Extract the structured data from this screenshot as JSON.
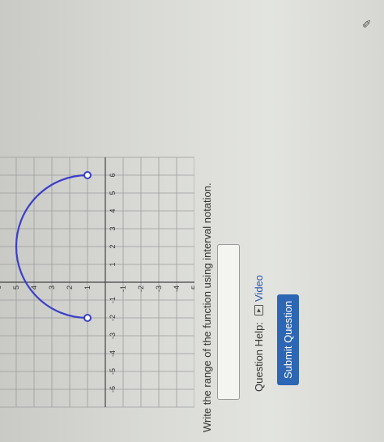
{
  "question": {
    "prompt": "Write the range of the function using interval notation.",
    "answer_value": "",
    "help_label": "Question Help:",
    "video_label": "Video",
    "submit_label": "Submit Question"
  },
  "graph": {
    "x_ticks": [
      "-6",
      "-5",
      "-4",
      "-3",
      "-2",
      "-1",
      "1",
      "2",
      "3",
      "4",
      "5",
      "6"
    ],
    "y_ticks": [
      "6",
      "5",
      "4",
      "3",
      "2",
      "1",
      "-1",
      "-2",
      "-3",
      "-4",
      "-5",
      "-6"
    ],
    "curve_color": "#3b3fc9",
    "endpoints": [
      {
        "x": -2,
        "y": 1,
        "style": "open"
      },
      {
        "x": 6,
        "y": 1,
        "style": "open"
      }
    ],
    "vertex": {
      "x": 2,
      "y": 5
    },
    "magnifier_icon": "magnifier-icon"
  },
  "corner_icon": "pencil-icon"
}
